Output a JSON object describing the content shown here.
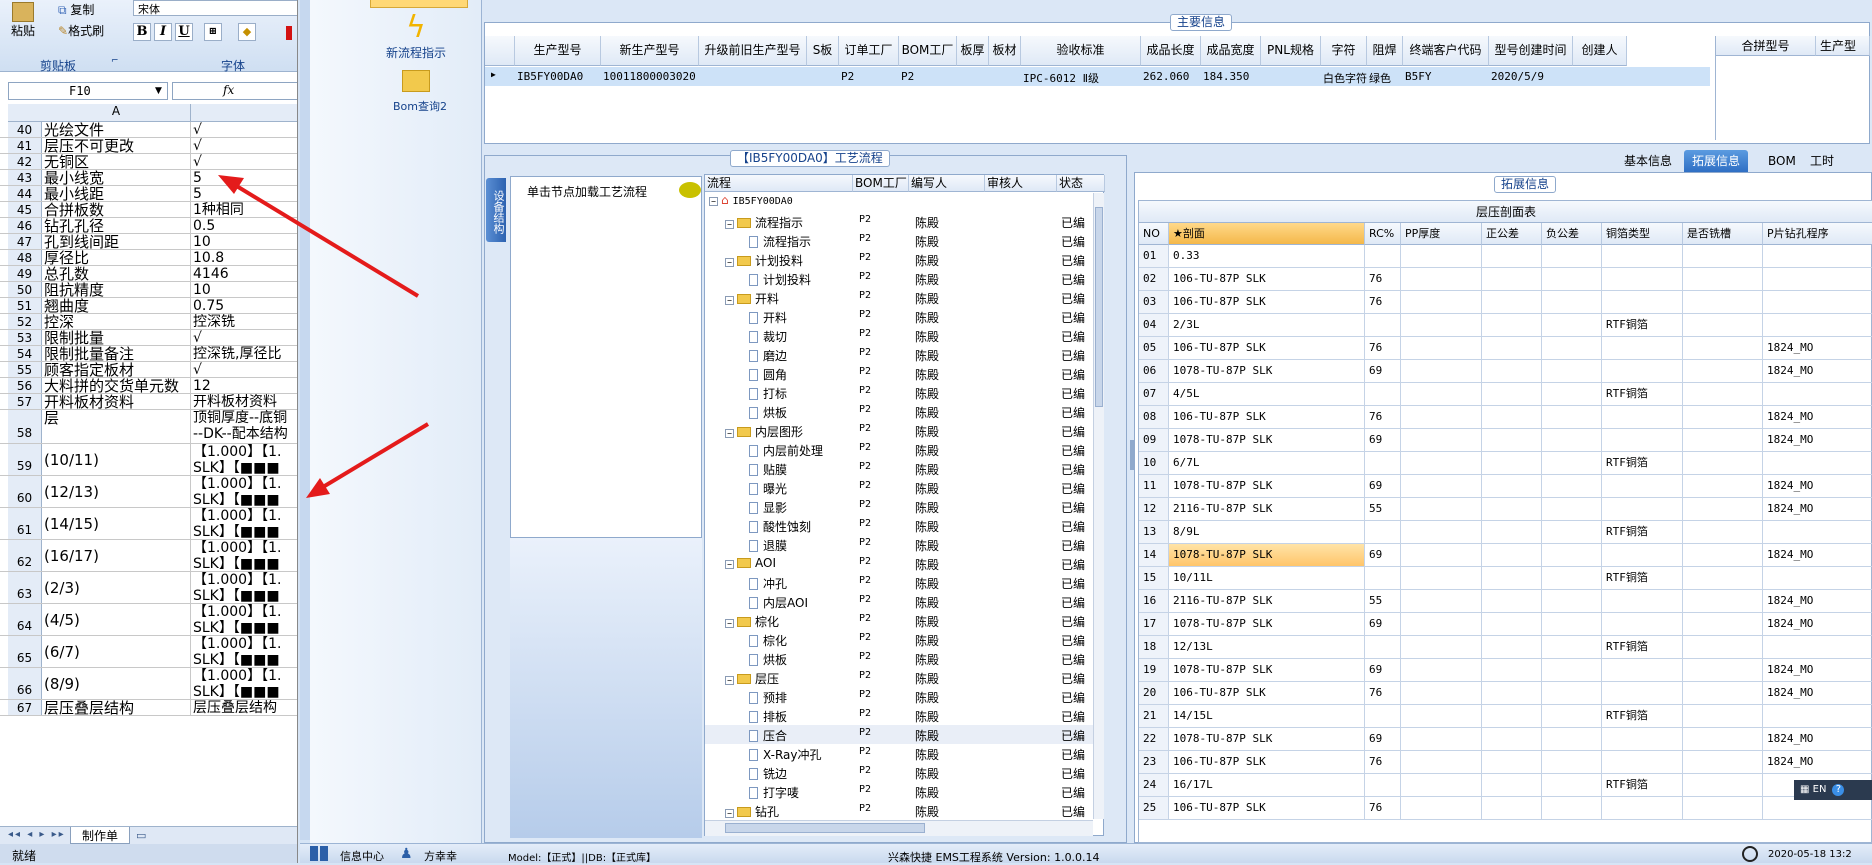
{
  "excel": {
    "ribbon": {
      "paste_label": "粘贴",
      "copy_label": "复制",
      "format_painter_label": "格式刷",
      "clipboard_group": "剪贴板",
      "font_group": "字体",
      "font_name_partial": "宋体",
      "bold": "B",
      "italic": "I",
      "underline": "U"
    },
    "name_box": "F10",
    "fx": "fx",
    "column_a": "A",
    "rows": [
      {
        "n": "40",
        "a": "光绘文件",
        "b": "√"
      },
      {
        "n": "41",
        "a": "层压不可更改",
        "b": "√"
      },
      {
        "n": "42",
        "a": "无铜区",
        "b": "√"
      },
      {
        "n": "43",
        "a": "最小线宽",
        "b": "5"
      },
      {
        "n": "44",
        "a": "最小线距",
        "b": "5"
      },
      {
        "n": "45",
        "a": "合拼板数",
        "b": "1种相同"
      },
      {
        "n": "46",
        "a": "钻孔孔径",
        "b": "0.5"
      },
      {
        "n": "47",
        "a": "孔到线间距",
        "b": "10"
      },
      {
        "n": "48",
        "a": "厚径比",
        "b": "10.8"
      },
      {
        "n": "49",
        "a": "总孔数",
        "b": "4146"
      },
      {
        "n": "50",
        "a": "阻抗精度",
        "b": "10"
      },
      {
        "n": "51",
        "a": "翘曲度",
        "b": "0.75"
      },
      {
        "n": "52",
        "a": "控深",
        "b": "控深铣"
      },
      {
        "n": "53",
        "a": "限制批量",
        "b": "√"
      },
      {
        "n": "54",
        "a": "限制批量备注",
        "b": "控深铣,厚径比"
      },
      {
        "n": "55",
        "a": "顾客指定板材",
        "b": "√"
      },
      {
        "n": "56",
        "a": "大料拼的交货单元数",
        "b": "12"
      },
      {
        "n": "57",
        "a": "开料板材资料",
        "b": "开料板材资料"
      },
      {
        "n": "58",
        "a": "层",
        "b": "顶铜厚度--底铜",
        "b2": "--DK--配本结构"
      },
      {
        "n": "59",
        "a": "(10/11)",
        "b": "【1.000】【1.",
        "b2": "SLK】【■■■"
      },
      {
        "n": "60",
        "a": "(12/13)",
        "b": "【1.000】【1.",
        "b2": "SLK】【■■■"
      },
      {
        "n": "61",
        "a": "(14/15)",
        "b": "【1.000】【1.",
        "b2": "SLK】【■■■"
      },
      {
        "n": "62",
        "a": "(16/17)",
        "b": "【1.000】【1.",
        "b2": "SLK】【■■■"
      },
      {
        "n": "63",
        "a": "(2/3)",
        "b": "【1.000】【1.",
        "b2": "SLK】【■■■"
      },
      {
        "n": "64",
        "a": "(4/5)",
        "b": "【1.000】【1.",
        "b2": "SLK】【■■■"
      },
      {
        "n": "65",
        "a": "(6/7)",
        "b": "【1.000】【1.",
        "b2": "SLK】【■■■"
      },
      {
        "n": "66",
        "a": "(8/9)",
        "b": "【1.000】【1.",
        "b2": "SLK】【■■■"
      },
      {
        "n": "67",
        "a": "层压叠层结构",
        "b": "层压叠层结构"
      }
    ],
    "sheet_tab": "制作单",
    "status": "就绪"
  },
  "launcher": {
    "item1": "新流程指示",
    "item2": "Bom查询2"
  },
  "main_info": {
    "title": "主要信息",
    "columns": [
      "生产型号",
      "新生产型号",
      "升级前旧生产型号",
      "S板",
      "订单工厂",
      "BOM工厂",
      "板厚",
      "板材",
      "验收标准",
      "成品长度",
      "成品宽度",
      "PNL规格",
      "字符",
      "阻焊",
      "终端客户代码",
      "型号创建时间",
      "创建人"
    ],
    "row": [
      "IB5FY00DA0",
      "10011800003020",
      "",
      "",
      "P2",
      "P2",
      "",
      "",
      "IPC-6012 Ⅱ级",
      "262.060",
      "184.350",
      "",
      "白色字符",
      "绿色",
      "B5FY",
      "2020/5/9",
      ""
    ],
    "side_columns": [
      "合拼型号",
      "生产型"
    ]
  },
  "process": {
    "title": "【IB5FY00DA0】工艺流程",
    "vertical_tab": "设备结构",
    "load_hint": "单击节点加载工艺流程",
    "columns": [
      "流程",
      "BOM工厂",
      "编写人",
      "审核人",
      "状态"
    ],
    "root": "IB5FY00DA0",
    "nodes": [
      {
        "label": "流程指示",
        "folder": true,
        "f": "P2",
        "w": "陈殿",
        "s": "已编"
      },
      {
        "label": "流程指示",
        "folder": false,
        "f": "P2",
        "w": "陈殿",
        "s": "已编"
      },
      {
        "label": "计划投料",
        "folder": true,
        "f": "P2",
        "w": "陈殿",
        "s": "已编"
      },
      {
        "label": "计划投料",
        "folder": false,
        "f": "P2",
        "w": "陈殿",
        "s": "已编"
      },
      {
        "label": "开料",
        "folder": true,
        "f": "P2",
        "w": "陈殿",
        "s": "已编"
      },
      {
        "label": "开料",
        "folder": false,
        "f": "P2",
        "w": "陈殿",
        "s": "已编"
      },
      {
        "label": "裁切",
        "folder": false,
        "f": "P2",
        "w": "陈殿",
        "s": "已编"
      },
      {
        "label": "磨边",
        "folder": false,
        "f": "P2",
        "w": "陈殿",
        "s": "已编"
      },
      {
        "label": "圆角",
        "folder": false,
        "f": "P2",
        "w": "陈殿",
        "s": "已编"
      },
      {
        "label": "打标",
        "folder": false,
        "f": "P2",
        "w": "陈殿",
        "s": "已编"
      },
      {
        "label": "烘板",
        "folder": false,
        "f": "P2",
        "w": "陈殿",
        "s": "已编"
      },
      {
        "label": "内层图形",
        "folder": true,
        "f": "P2",
        "w": "陈殿",
        "s": "已编"
      },
      {
        "label": "内层前处理",
        "folder": false,
        "f": "P2",
        "w": "陈殿",
        "s": "已编"
      },
      {
        "label": "贴膜",
        "folder": false,
        "f": "P2",
        "w": "陈殿",
        "s": "已编"
      },
      {
        "label": "曝光",
        "folder": false,
        "f": "P2",
        "w": "陈殿",
        "s": "已编"
      },
      {
        "label": "显影",
        "folder": false,
        "f": "P2",
        "w": "陈殿",
        "s": "已编"
      },
      {
        "label": "酸性蚀刻",
        "folder": false,
        "f": "P2",
        "w": "陈殿",
        "s": "已编"
      },
      {
        "label": "退膜",
        "folder": false,
        "f": "P2",
        "w": "陈殿",
        "s": "已编"
      },
      {
        "label": "AOI",
        "folder": true,
        "f": "P2",
        "w": "陈殿",
        "s": "已编"
      },
      {
        "label": "冲孔",
        "folder": false,
        "f": "P2",
        "w": "陈殿",
        "s": "已编"
      },
      {
        "label": "内层AOI",
        "folder": false,
        "f": "P2",
        "w": "陈殿",
        "s": "已编"
      },
      {
        "label": "棕化",
        "folder": true,
        "f": "P2",
        "w": "陈殿",
        "s": "已编"
      },
      {
        "label": "棕化",
        "folder": false,
        "f": "P2",
        "w": "陈殿",
        "s": "已编"
      },
      {
        "label": "烘板",
        "folder": false,
        "f": "P2",
        "w": "陈殿",
        "s": "已编"
      },
      {
        "label": "层压",
        "folder": true,
        "f": "P2",
        "w": "陈殿",
        "s": "已编"
      },
      {
        "label": "预排",
        "folder": false,
        "f": "P2",
        "w": "陈殿",
        "s": "已编"
      },
      {
        "label": "排板",
        "folder": false,
        "f": "P2",
        "w": "陈殿",
        "s": "已编"
      },
      {
        "label": "压合",
        "folder": false,
        "f": "P2",
        "w": "陈殿",
        "s": "已编"
      },
      {
        "label": "X-Ray冲孔",
        "folder": false,
        "f": "P2",
        "w": "陈殿",
        "s": "已编"
      },
      {
        "label": "铣边",
        "folder": false,
        "f": "P2",
        "w": "陈殿",
        "s": "已编"
      },
      {
        "label": "打字唛",
        "folder": false,
        "f": "P2",
        "w": "陈殿",
        "s": "已编"
      },
      {
        "label": "钻孔",
        "folder": true,
        "f": "P2",
        "w": "陈殿",
        "s": "已编"
      }
    ]
  },
  "tabs": [
    "基本信息",
    "拓展信息",
    "BOM",
    "工时"
  ],
  "ext": {
    "title": "拓展信息",
    "table_title": "层压剖面表",
    "columns": [
      "NO",
      "★剖面",
      "RC%",
      "PP厚度",
      "正公差",
      "负公差",
      "铜箔类型",
      "是否铣槽",
      "P片钻孔程序"
    ],
    "rows": [
      [
        "01",
        "0.33",
        "",
        "",
        "",
        "",
        "",
        "",
        ""
      ],
      [
        "02",
        "106-TU-87P SLK",
        "76",
        "",
        "",
        "",
        "",
        "",
        ""
      ],
      [
        "03",
        "106-TU-87P SLK",
        "76",
        "",
        "",
        "",
        "",
        "",
        ""
      ],
      [
        "04",
        "2/3L",
        "",
        "",
        "",
        "",
        "RTF铜箔",
        "",
        ""
      ],
      [
        "05",
        "106-TU-87P SLK",
        "76",
        "",
        "",
        "",
        "",
        "",
        "1824_MO"
      ],
      [
        "06",
        "1078-TU-87P SLK",
        "69",
        "",
        "",
        "",
        "",
        "",
        "1824_MO"
      ],
      [
        "07",
        "4/5L",
        "",
        "",
        "",
        "",
        "RTF铜箔",
        "",
        ""
      ],
      [
        "08",
        "106-TU-87P SLK",
        "76",
        "",
        "",
        "",
        "",
        "",
        "1824_MO"
      ],
      [
        "09",
        "1078-TU-87P SLK",
        "69",
        "",
        "",
        "",
        "",
        "",
        "1824_MO"
      ],
      [
        "10",
        "6/7L",
        "",
        "",
        "",
        "",
        "RTF铜箔",
        "",
        ""
      ],
      [
        "11",
        "1078-TU-87P SLK",
        "69",
        "",
        "",
        "",
        "",
        "",
        "1824_MO"
      ],
      [
        "12",
        "2116-TU-87P SLK",
        "55",
        "",
        "",
        "",
        "",
        "",
        "1824_MO"
      ],
      [
        "13",
        "8/9L",
        "",
        "",
        "",
        "",
        "RTF铜箔",
        "",
        ""
      ],
      [
        "14",
        "1078-TU-87P SLK",
        "69",
        "",
        "",
        "",
        "",
        "",
        "1824_MO"
      ],
      [
        "15",
        "10/11L",
        "",
        "",
        "",
        "",
        "RTF铜箔",
        "",
        ""
      ],
      [
        "16",
        "2116-TU-87P SLK",
        "55",
        "",
        "",
        "",
        "",
        "",
        "1824_MO"
      ],
      [
        "17",
        "1078-TU-87P SLK",
        "69",
        "",
        "",
        "",
        "",
        "",
        "1824_MO"
      ],
      [
        "18",
        "12/13L",
        "",
        "",
        "",
        "",
        "RTF铜箔",
        "",
        ""
      ],
      [
        "19",
        "1078-TU-87P SLK",
        "69",
        "",
        "",
        "",
        "",
        "",
        "1824_MO"
      ],
      [
        "20",
        "106-TU-87P SLK",
        "76",
        "",
        "",
        "",
        "",
        "",
        "1824_MO"
      ],
      [
        "21",
        "14/15L",
        "",
        "",
        "",
        "",
        "RTF铜箔",
        "",
        ""
      ],
      [
        "22",
        "1078-TU-87P SLK",
        "69",
        "",
        "",
        "",
        "",
        "",
        "1824_MO"
      ],
      [
        "23",
        "106-TU-87P SLK",
        "76",
        "",
        "",
        "",
        "",
        "",
        "1824_MO"
      ],
      [
        "24",
        "16/17L",
        "",
        "",
        "",
        "",
        "RTF铜箔",
        "",
        ""
      ],
      [
        "25",
        "106-TU-87P SLK",
        "76",
        "",
        "",
        "",
        "",
        "",
        ""
      ]
    ],
    "selected_row": "14"
  },
  "statusbar": {
    "info_center": "信息中心",
    "user": "方幸幸",
    "model": "Model:【正式】||DB:【正式库】",
    "app": "兴森快捷 EMS工程系统 Version: 1.0.0.14",
    "time": "2020-05-18 13:2",
    "lang": "EN"
  },
  "colors": {
    "accent": "#2f6fc4",
    "selected_row": "#ffc56a",
    "arrow": "#e41b1b"
  }
}
